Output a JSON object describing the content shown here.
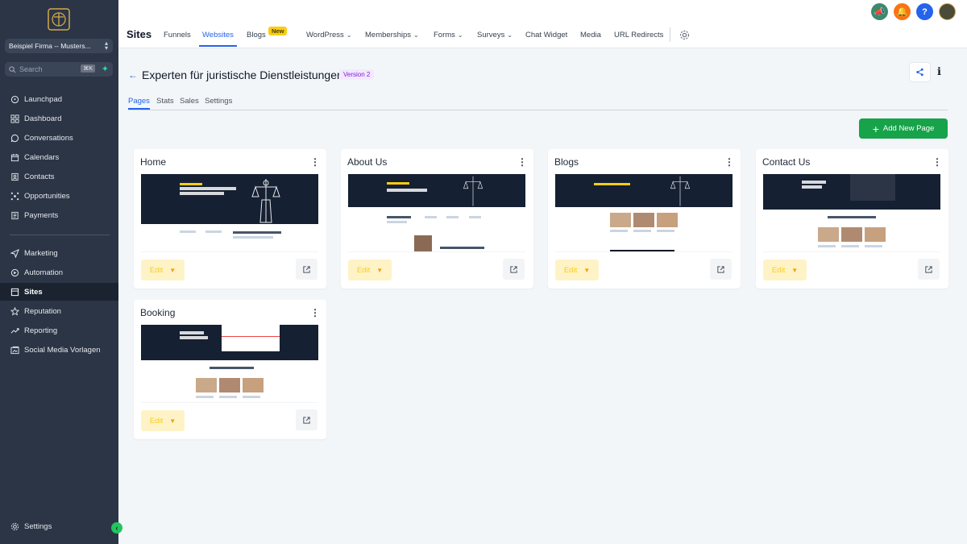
{
  "sidebar": {
    "account": "Beispiel Firma -- Musters...",
    "search_placeholder": "Search",
    "search_shortcut": "⌘K",
    "items": [
      {
        "label": "Launchpad",
        "icon": "rocket-icon"
      },
      {
        "label": "Dashboard",
        "icon": "dashboard-icon"
      },
      {
        "label": "Conversations",
        "icon": "chat-icon"
      },
      {
        "label": "Calendars",
        "icon": "calendar-icon"
      },
      {
        "label": "Contacts",
        "icon": "contacts-icon"
      },
      {
        "label": "Opportunities",
        "icon": "opportunities-icon"
      },
      {
        "label": "Payments",
        "icon": "payments-icon"
      },
      {
        "label": "Marketing",
        "icon": "send-icon"
      },
      {
        "label": "Automation",
        "icon": "automation-icon"
      },
      {
        "label": "Sites",
        "icon": "globe-icon",
        "active": true
      },
      {
        "label": "Reputation",
        "icon": "star-icon"
      },
      {
        "label": "Reporting",
        "icon": "trend-icon"
      },
      {
        "label": "Social Media Vorlagen",
        "icon": "social-icon"
      }
    ],
    "settings": "Settings"
  },
  "topbar": {
    "title": "Sites",
    "tabs": [
      "Funnels",
      "Websites",
      "Blogs",
      "WordPress",
      "Memberships",
      "Forms",
      "Surveys",
      "Chat Widget",
      "Media",
      "URL Redirects"
    ],
    "new_badge": "New",
    "help": "?"
  },
  "main": {
    "back": "←",
    "title": "Experten für juristische Dienstleistungen",
    "version": "Version 2",
    "subtabs": [
      "Pages",
      "Stats",
      "Sales",
      "Settings"
    ],
    "add_button": "Add New Page",
    "edit_label": "Edit",
    "pages": [
      "Home",
      "About Us",
      "Blogs",
      "Contact Us",
      "Booking"
    ]
  },
  "colors": {
    "sidebar_bg": "#2b3546",
    "accent": "#2563eb",
    "add_button": "#16a34a",
    "edit_bg": "#fef3c7"
  }
}
